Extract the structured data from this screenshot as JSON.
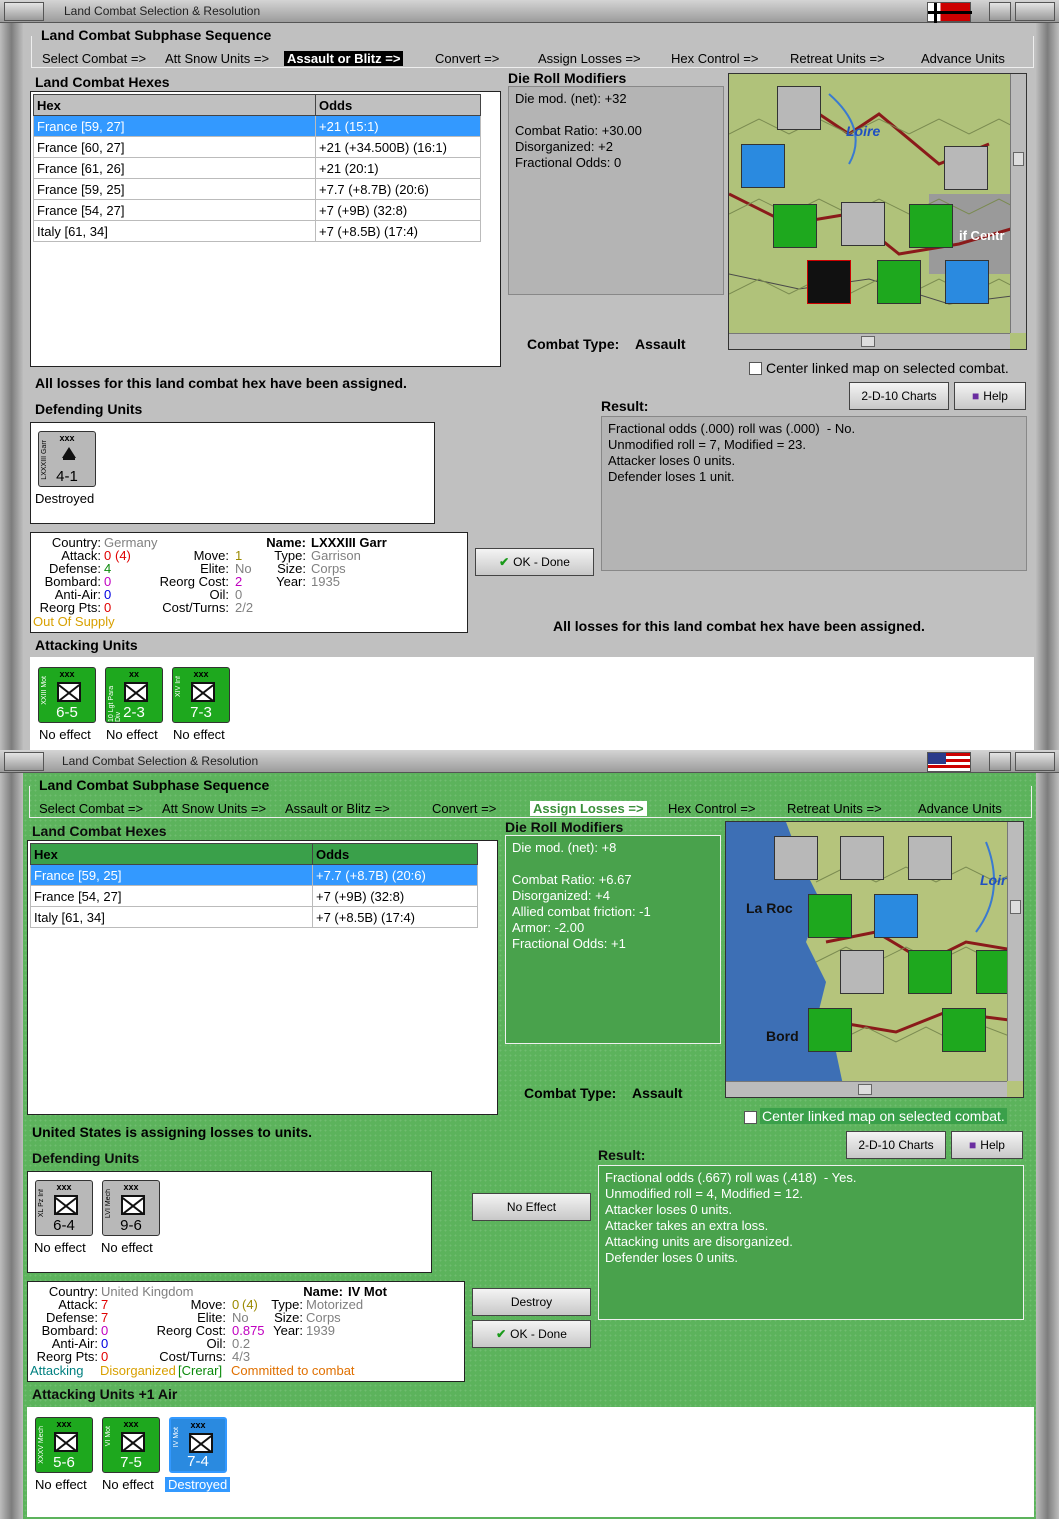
{
  "win1": {
    "title": "Land Combat Selection & Resolution",
    "sequence_title": "Land Combat Subphase Sequence",
    "sequence": [
      "Select Combat =>",
      "Att Snow Units =>",
      "Assault or Blitz =>",
      "Convert =>",
      "Assign Losses =>",
      "Hex Control =>",
      "Retreat Units =>",
      "Advance Units"
    ],
    "active_step": "Assault or Blitz =>",
    "hexes_label": "Land Combat Hexes",
    "col_hex": "Hex",
    "col_odds": "Odds",
    "rows": [
      {
        "hex": "France [59, 27]",
        "odds": "+21 (15:1)"
      },
      {
        "hex": "France [60, 27]",
        "odds": "+21 (+34.500B) (16:1)"
      },
      {
        "hex": "France [61, 26]",
        "odds": "+21 (20:1)"
      },
      {
        "hex": "France [59, 25]",
        "odds": "+7.7 (+8.7B) (20:6)"
      },
      {
        "hex": "France [54, 27]",
        "odds": "+7 (+9B) (32:8)"
      },
      {
        "hex": "Italy [61, 34]",
        "odds": "+7 (+8.5B) (17:4)"
      }
    ],
    "drm_label": "Die Roll Modifiers",
    "drm_lines": "Die mod. (net): +32\n\nCombat Ratio: +30.00\nDisorganized: +2\nFractional Odds: 0",
    "combat_type_label": "Combat Type:",
    "combat_type": "Assault",
    "center_map_label": "Center linked map on selected combat.",
    "charts_btn": "2-D-10 Charts",
    "help_btn": "Help",
    "status_msg": "All losses for this land combat hex have been assigned.",
    "defending_label": "Defending Units",
    "result_label": "Result:",
    "result_lines": "Fractional odds (.000) roll was (.000)  - No.\nUnmodified roll = 7, Modified = 23.\nAttacker loses 0 units.\nDefender loses 1 unit.",
    "ok_btn": "OK - Done",
    "status_msg2": "All losses for this land combat hex have been assigned.",
    "attacking_label": "Attacking Units",
    "defenders": [
      {
        "name": "LXXXIII Garr",
        "size": "xxx",
        "str": "4-1",
        "status": "Destroyed",
        "color": "gray"
      }
    ],
    "attackers": [
      {
        "name": "XXIII Mot",
        "size": "xxx",
        "str": "6-5",
        "status": "No effect",
        "color": "green"
      },
      {
        "name": "10 Lgt Para Div",
        "size": "xx",
        "str": "2-3",
        "status": "No effect",
        "color": "green"
      },
      {
        "name": "XIV Inf",
        "size": "xxx",
        "str": "7-3",
        "status": "No effect",
        "color": "green"
      }
    ],
    "info": {
      "country_k": "Country:",
      "country_v": "Germany",
      "attack_k": "Attack:",
      "attack_v": "0",
      "attack_x": "(4)",
      "defense_k": "Defense:",
      "defense_v": "4",
      "bombard_k": "Bombard:",
      "bombard_v": "0",
      "antiair_k": "Anti-Air:",
      "antiair_v": "0",
      "reorg_k": "Reorg Pts:",
      "reorg_v": "0",
      "move_k": "Move:",
      "move_v": "1",
      "elite_k": "Elite:",
      "elite_v": "No",
      "reorgcost_k": "Reorg Cost:",
      "reorgcost_v": "2",
      "oil_k": "Oil:",
      "oil_v": "0",
      "costturns_k": "Cost/Turns:",
      "costturns_v": "2/2",
      "name_k": "Name:",
      "name_v": "LXXXIII Garr",
      "type_k": "Type:",
      "type_v": "Garrison",
      "size_k": "Size:",
      "size_v": "Corps",
      "year_k": "Year:",
      "year_v": "1935",
      "supply": "Out Of Supply"
    },
    "map_labels": {
      "loire": "Loire",
      "centre": "if Centr"
    }
  },
  "win2": {
    "title": "Land Combat Selection & Resolution",
    "sequence_title": "Land Combat Subphase Sequence",
    "sequence": [
      "Select Combat =>",
      "Att Snow Units =>",
      "Assault or Blitz =>",
      "Convert =>",
      "Assign Losses =>",
      "Hex Control =>",
      "Retreat Units =>",
      "Advance Units"
    ],
    "active_step": "Assign Losses =>",
    "hexes_label": "Land Combat Hexes",
    "col_hex": "Hex",
    "col_odds": "Odds",
    "rows": [
      {
        "hex": "France [59, 25]",
        "odds": "+7.7 (+8.7B) (20:6)"
      },
      {
        "hex": "France [54, 27]",
        "odds": "+7 (+9B) (32:8)"
      },
      {
        "hex": "Italy [61, 34]",
        "odds": "+7 (+8.5B) (17:4)"
      }
    ],
    "drm_label": "Die Roll Modifiers",
    "drm_lines": "Die mod. (net): +8\n\nCombat Ratio: +6.67\nDisorganized: +4\nAllied combat friction: -1\nArmor: -2.00\nFractional Odds: +1",
    "combat_type_label": "Combat Type:",
    "combat_type": "Assault",
    "center_map_label": "Center linked map on selected combat.",
    "charts_btn": "2-D-10 Charts",
    "help_btn": "Help",
    "status_msg": "United States is assigning losses to units.",
    "defending_label": "Defending Units",
    "result_label": "Result:",
    "result_lines": "Fractional odds (.667) roll was (.418)  - Yes.\nUnmodified roll = 4, Modified = 12.\nAttacker loses 0 units.\nAttacker takes an extra loss.\nAttacking units are disorganized.\nDefender loses 0 units.",
    "no_effect_btn": "No Effect",
    "destroy_btn": "Destroy",
    "ok_btn": "OK - Done",
    "attacking_label": "Attacking Units +1 Air",
    "defenders": [
      {
        "name": "XL Pz Inf",
        "size": "xxx",
        "str": "6-4",
        "status": "No effect",
        "color": "gray"
      },
      {
        "name": "LVI Mech",
        "size": "xxx",
        "str": "9-6",
        "status": "No effect",
        "color": "gray"
      }
    ],
    "attackers": [
      {
        "name": "XXXV Mech",
        "size": "xxx",
        "str": "5-6",
        "status": "No effect",
        "color": "green"
      },
      {
        "name": "VI Mot",
        "size": "xxx",
        "str": "7-5",
        "status": "No effect",
        "color": "green"
      },
      {
        "name": "IV Mot",
        "size": "xxx",
        "str": "7-4",
        "status": "Destroyed",
        "color": "blue"
      }
    ],
    "info": {
      "country_k": "Country:",
      "country_v": "United Kingdom",
      "attack_k": "Attack:",
      "attack_v": "7",
      "defense_k": "Defense:",
      "defense_v": "7",
      "bombard_k": "Bombard:",
      "bombard_v": "0",
      "antiair_k": "Anti-Air:",
      "antiair_v": "0",
      "reorg_k": "Reorg Pts:",
      "reorg_v": "0",
      "move_k": "Move:",
      "move_v": "0",
      "move_x": "(4)",
      "elite_k": "Elite:",
      "elite_v": "No",
      "reorgcost_k": "Reorg Cost:",
      "reorgcost_v": "0.875",
      "oil_k": "Oil:",
      "oil_v": "0.2",
      "costturns_k": "Cost/Turns:",
      "costturns_v": "4/3",
      "name_k": "Name:",
      "name_v": "IV Mot",
      "type_k": "Type:",
      "type_v": "Motorized",
      "size_k": "Size:",
      "size_v": "Corps",
      "year_k": "Year:",
      "year_v": "1939",
      "flag_attacking": "Attacking",
      "flag_disorg": "Disorganized",
      "flag_crerar": "[Crerar]",
      "flag_committed": "Committed to combat"
    },
    "map_labels": {
      "laroc": "La Roc",
      "bord": "Bord",
      "loir": "Loir"
    }
  },
  "colors": {
    "selected_row": "#3399ff",
    "us_green": "#5cb35c",
    "german_gray": "#c0c0c0",
    "active_step_bg": "#000000"
  }
}
